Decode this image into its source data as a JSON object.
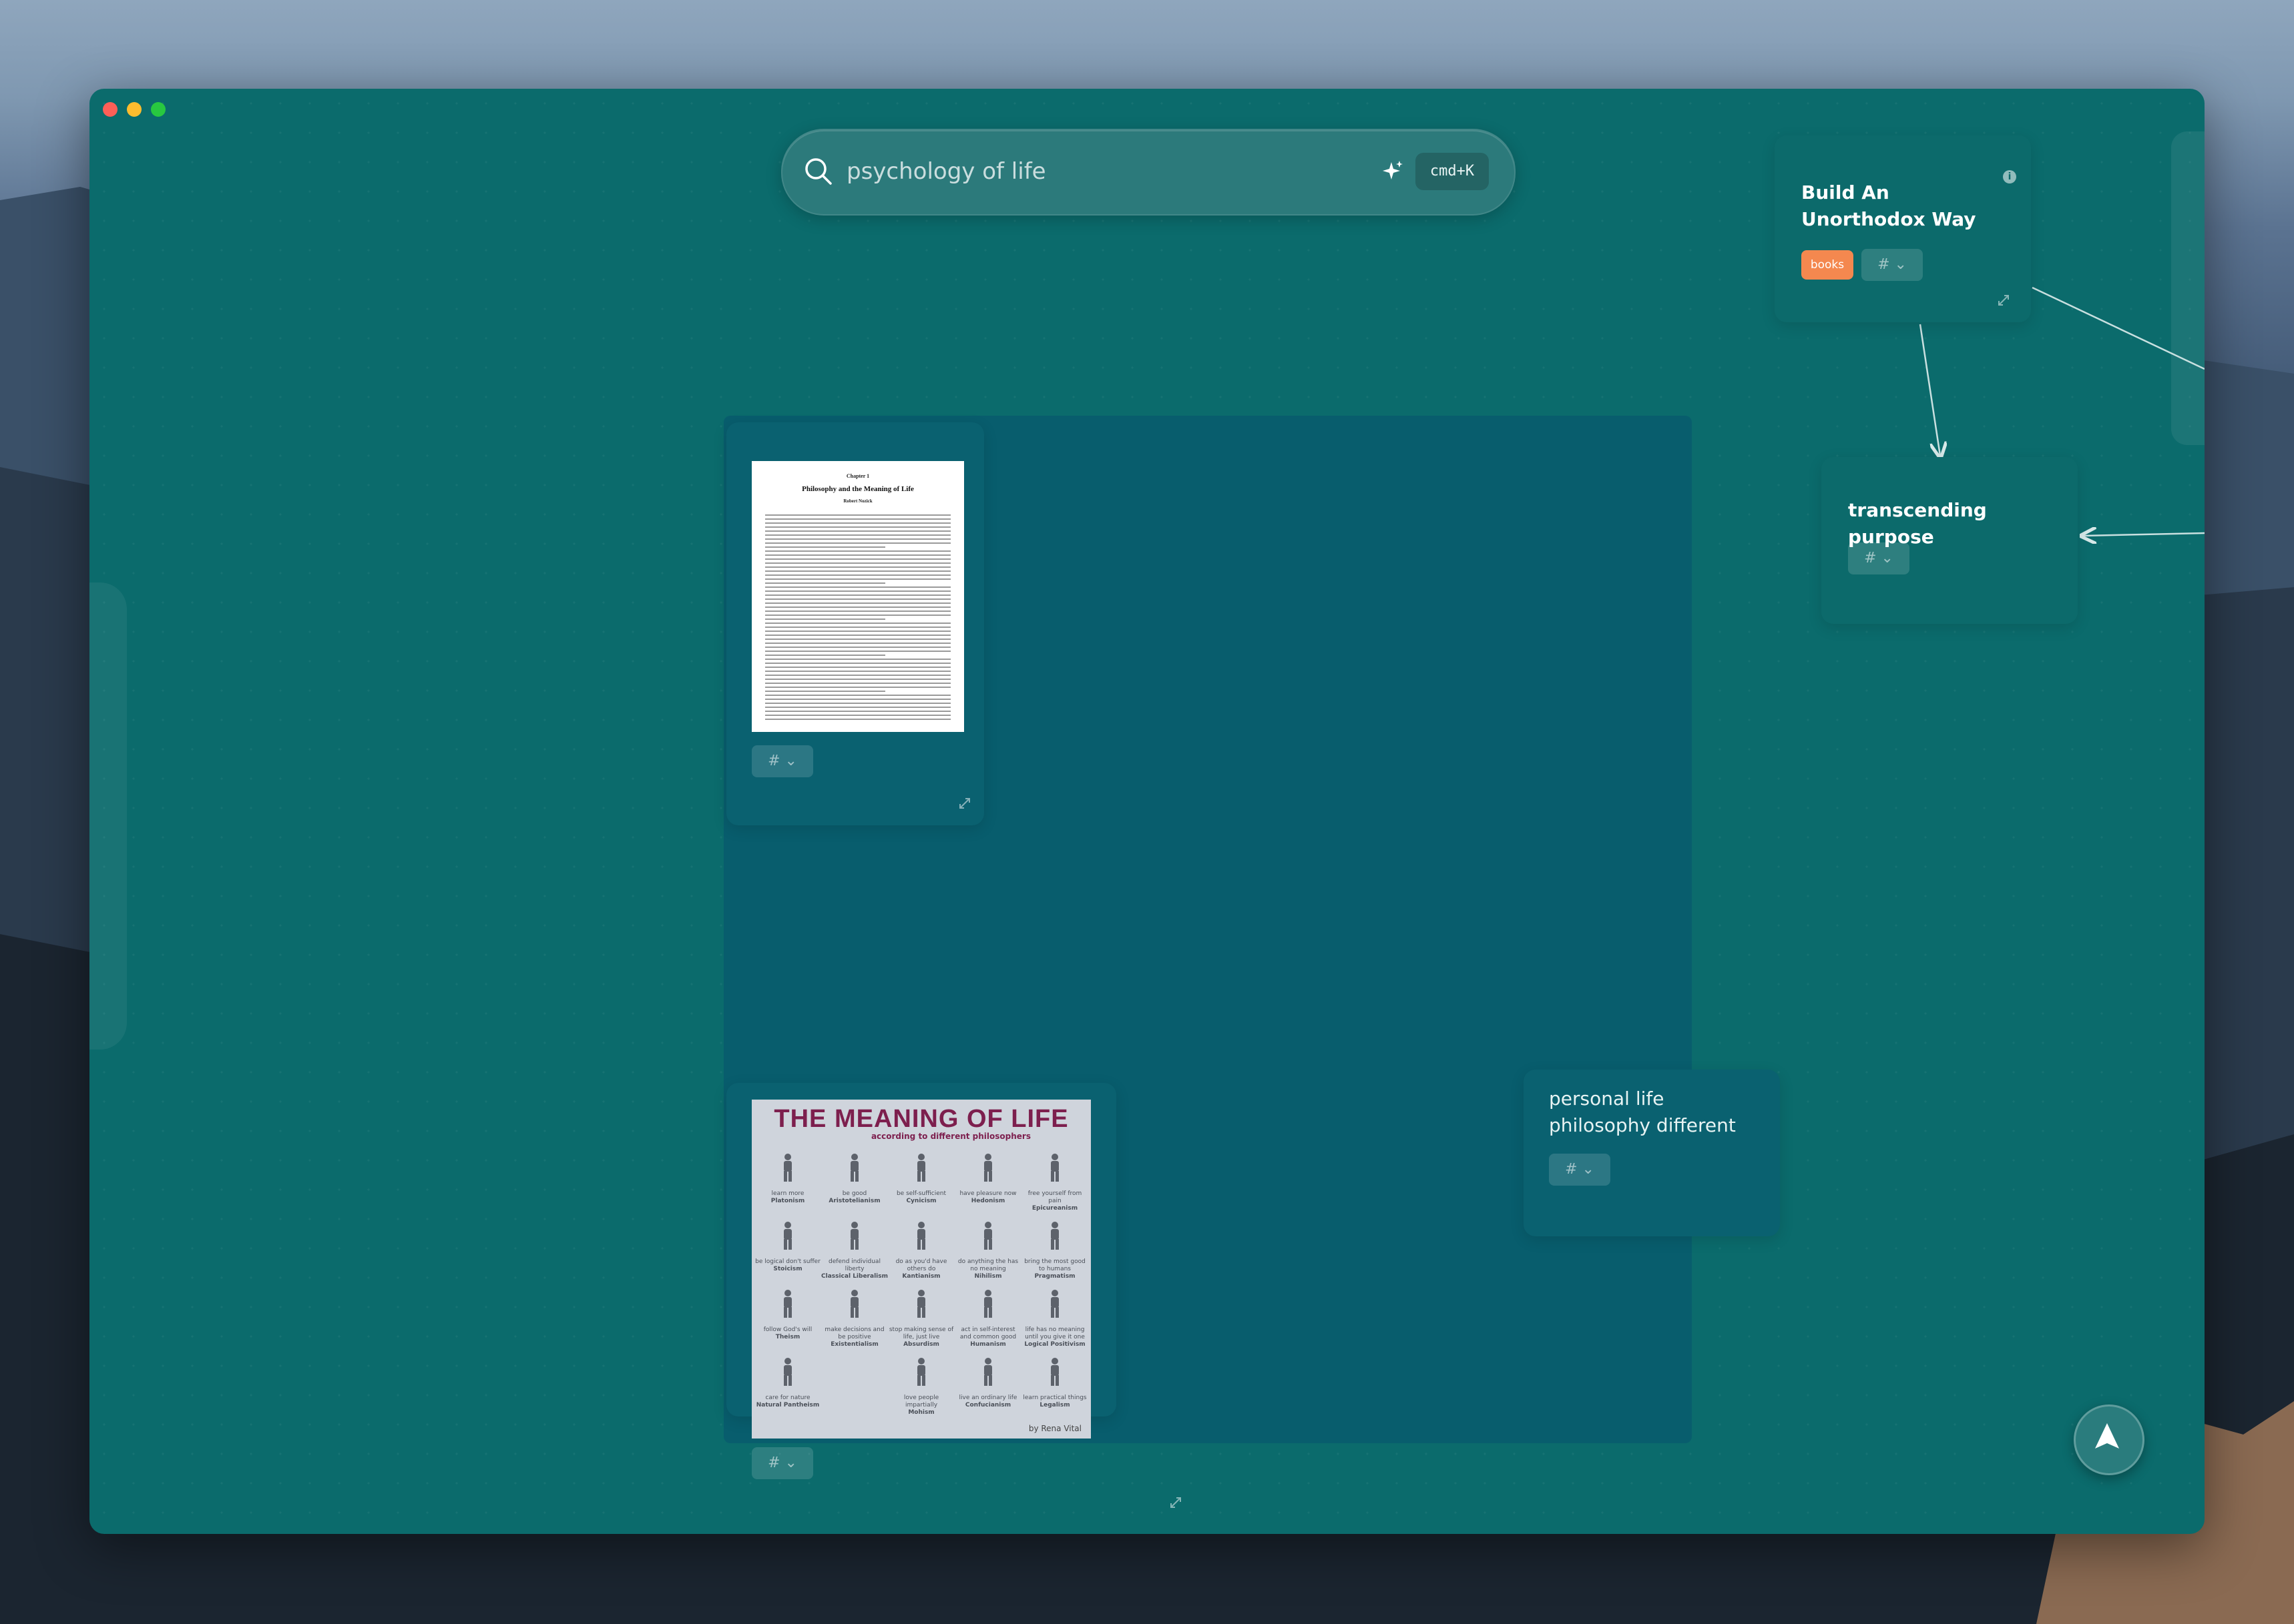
{
  "search": {
    "query": "psychology of life",
    "shortcut": "cmd+K"
  },
  "cards": {
    "build_unorthodox": {
      "title": "Build An Unorthodox Way",
      "tags": [
        "books"
      ],
      "tag_button": "# ⌄"
    },
    "transcending_purpose": {
      "title": "transcending purpose",
      "tag_button": "# ⌄"
    },
    "personal_philosophy": {
      "text": "personal life philosophy different",
      "tag_button": "# ⌄"
    },
    "pdf_document": {
      "chapter": "Chapter 1",
      "heading": "Philosophy and the Meaning of Life",
      "author": "Robert Nozick",
      "tag_button": "# ⌄"
    },
    "meaning_poster": {
      "title": "THE MEANING OF LIFE",
      "subtitle": "according to different philosophers",
      "byline": "by Rena Vital",
      "cells": [
        {
          "caption": "learn more",
          "school": "Platonism"
        },
        {
          "caption": "be good",
          "school": "Aristotelianism"
        },
        {
          "caption": "be self-sufficient",
          "school": "Cynicism"
        },
        {
          "caption": "have pleasure now",
          "school": "Hedonism"
        },
        {
          "caption": "free yourself from pain",
          "school": "Epicureanism"
        },
        {
          "caption": "be logical don't suffer",
          "school": "Stoicism"
        },
        {
          "caption": "defend individual liberty",
          "school": "Classical Liberalism"
        },
        {
          "caption": "do as you'd have others do",
          "school": "Kantianism"
        },
        {
          "caption": "do anything the has no meaning",
          "school": "Nihilism"
        },
        {
          "caption": "bring the most good to humans",
          "school": "Pragmatism"
        },
        {
          "caption": "follow God's will",
          "school": "Theism"
        },
        {
          "caption": "make decisions and be positive",
          "school": "Existentialism"
        },
        {
          "caption": "stop making sense of life, just live",
          "school": "Absurdism"
        },
        {
          "caption": "act in self-interest and common good",
          "school": "Humanism"
        },
        {
          "caption": "life has no meaning until you give it one",
          "school": "Logical Positivism"
        },
        {
          "caption": "care for nature",
          "school": "Natural Pantheism"
        },
        {
          "caption": "love people impartially",
          "school": "Mohism"
        },
        {
          "caption": "live an ordinary life",
          "school": "Confucianism"
        },
        {
          "caption": "learn practical things",
          "school": "Legalism"
        }
      ],
      "tag_button": "# ⌄"
    }
  }
}
